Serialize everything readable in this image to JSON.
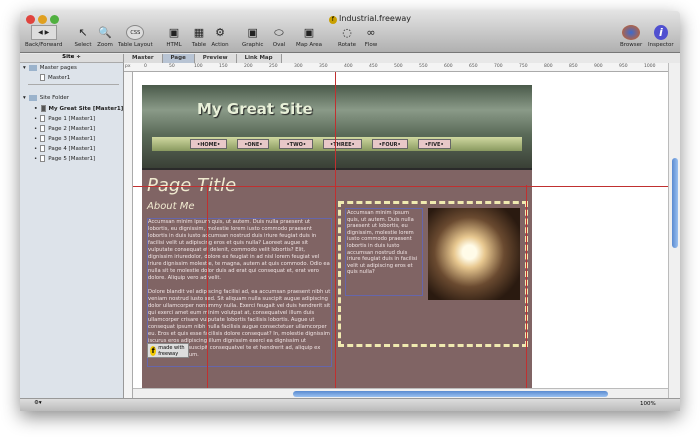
{
  "window": {
    "title": "Industrial.freeway"
  },
  "toolbar": [
    {
      "label": "Back/Forward",
      "icon": "back-forward-icon"
    },
    {
      "label": "Select",
      "icon": "select-icon"
    },
    {
      "label": "Zoom",
      "icon": "zoom-icon"
    },
    {
      "label": "Table Layout",
      "icon": "css-icon",
      "glyph": "CSS"
    },
    {
      "label": "HTML",
      "icon": "html-box-icon"
    },
    {
      "label": "Table",
      "icon": "table-icon"
    },
    {
      "label": "Action",
      "icon": "action-gear-icon"
    },
    {
      "label": "Graphic",
      "icon": "graphic-icon"
    },
    {
      "label": "Oval",
      "icon": "oval-icon"
    },
    {
      "label": "Map Area",
      "icon": "map-area-icon"
    },
    {
      "label": "Rotate",
      "icon": "rotate-icon"
    },
    {
      "label": "Flow",
      "icon": "flow-icon"
    },
    {
      "label": "Browser",
      "icon": "firefox-icon"
    },
    {
      "label": "Inspector",
      "icon": "info-icon"
    }
  ],
  "site_header": "Site ÷",
  "tabs": [
    "Master",
    "Page",
    "Preview",
    "Link Map"
  ],
  "active_tab": "Page",
  "sidebar": {
    "master_group": "Master pages",
    "masters": [
      "Master1"
    ],
    "site_group": "Site Folder",
    "pages": [
      "My Great Site [Master1]",
      "Page 1 [Master1]",
      "Page 2 [Master1]",
      "Page 3 [Master1]",
      "Page 4 [Master1]",
      "Page 5 [Master1]"
    ]
  },
  "ruler": {
    "unit": "px",
    "ticks": [
      "0",
      "50",
      "100",
      "150",
      "200",
      "250",
      "300",
      "350",
      "400",
      "450",
      "500",
      "550",
      "600",
      "650",
      "700",
      "750",
      "800",
      "850",
      "900",
      "950",
      "1000"
    ]
  },
  "page": {
    "site_name": "My Great Site",
    "nav": [
      "•HOME•",
      "•ONE•",
      "•TWO•",
      "•THREE•",
      "•FOUR•",
      "•FIVE•"
    ],
    "page_title": "Page Title",
    "heading": "About Me",
    "para1": "Accumsan minim ipsum quis, ut autem. Duis nulla praesent ut lobortis, eu dignissim, molestie lorem iusto commodo praesent lobortis in duis iusto accumsan nostrud duis iriure feugiat duis in facilisi velit ut adipiscing eros et quis nulla? Laoreet augue sit vulputate consequat et delenit, commodo velit lobortis? Elit, dignissim iriuredolor, dolore ex feugiat in ad nisl lorem feugiat vel iriure dignissim molestie, te magna, autem at quis commodo. Odio ea nulla sit te molestie dolor duis ad erat qui consequat et, erat vero dolore. Aliquip vero ad velit.",
    "para2": "Dolore blandit vel adipiscing facilisi ad, ea accumsan praesent nibh ut veniam nostrud iusto sed. Sit aliquam nulla suscipit augue adipiscing dolor ullamcorper nonummy nulla. Exerci feugait vel duis hendrerit sit qui exerci amet eum minim volutpat at, consequatvel illum duis ullamcorper crisare vulputate lobortis facilisis lobortis. Augue ut consequat ipsum nibh nulla facilisis augue consectetuer ullamcorper eu. Eros et quis esse facilisis dolore consequat? In, molestie dignissim iscurus eros adipiscing illum dignissim exerci ea dignissim ut dignissim, duis suscipit consequatvel te et hendrerit ad, aliquip ex duis luptatum eum.",
    "side_text": "Accumsan minim ipsum quis, ut autem. Duis nulla praesent ut lobortis, eu dignissim, molestie lorem iusto commodo praesent lobortis in duis iusto accumsan nostrud duis iriure feugiat duis in facilisi velit ut adipiscing eros et quis nulla?",
    "badge": "made with freeway"
  },
  "status": {
    "zoom": "100%"
  }
}
